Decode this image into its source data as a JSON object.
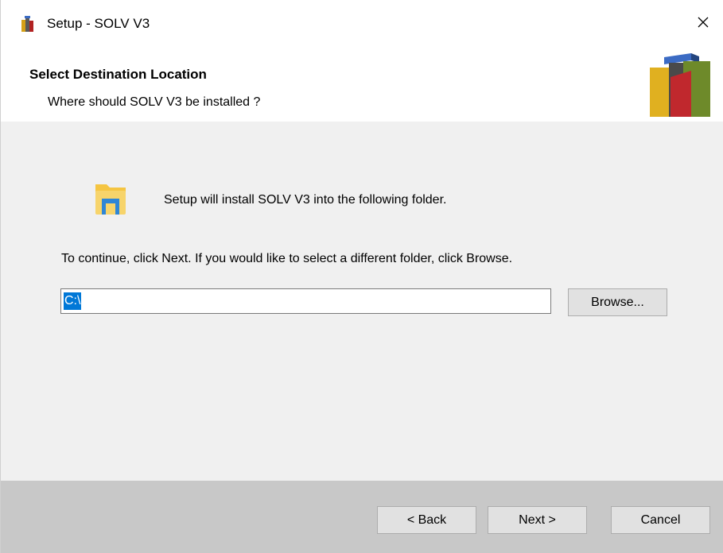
{
  "window": {
    "title": "Setup - SOLV V3",
    "close_glyph": "✕"
  },
  "header": {
    "title": "Select Destination Location",
    "subtitle": "Where should SOLV V3 be installed ?",
    "logo_icon": "books-logo-icon"
  },
  "body": {
    "folder_icon": "folder-icon",
    "install_text": "Setup will install SOLV V3 into the following folder.",
    "continue_text": "To continue, click Next. If you would like to select a different folder, click Browse.",
    "path_value": "C:\\",
    "browse_label": "Browse..."
  },
  "footer": {
    "back_label": "< Back",
    "next_label": "Next >",
    "cancel_label": "Cancel"
  },
  "colors": {
    "selection": "#0078d7",
    "footer_bg": "#c8c8c8",
    "body_bg": "#f0f0f0",
    "header_bg": "#ffffff"
  }
}
